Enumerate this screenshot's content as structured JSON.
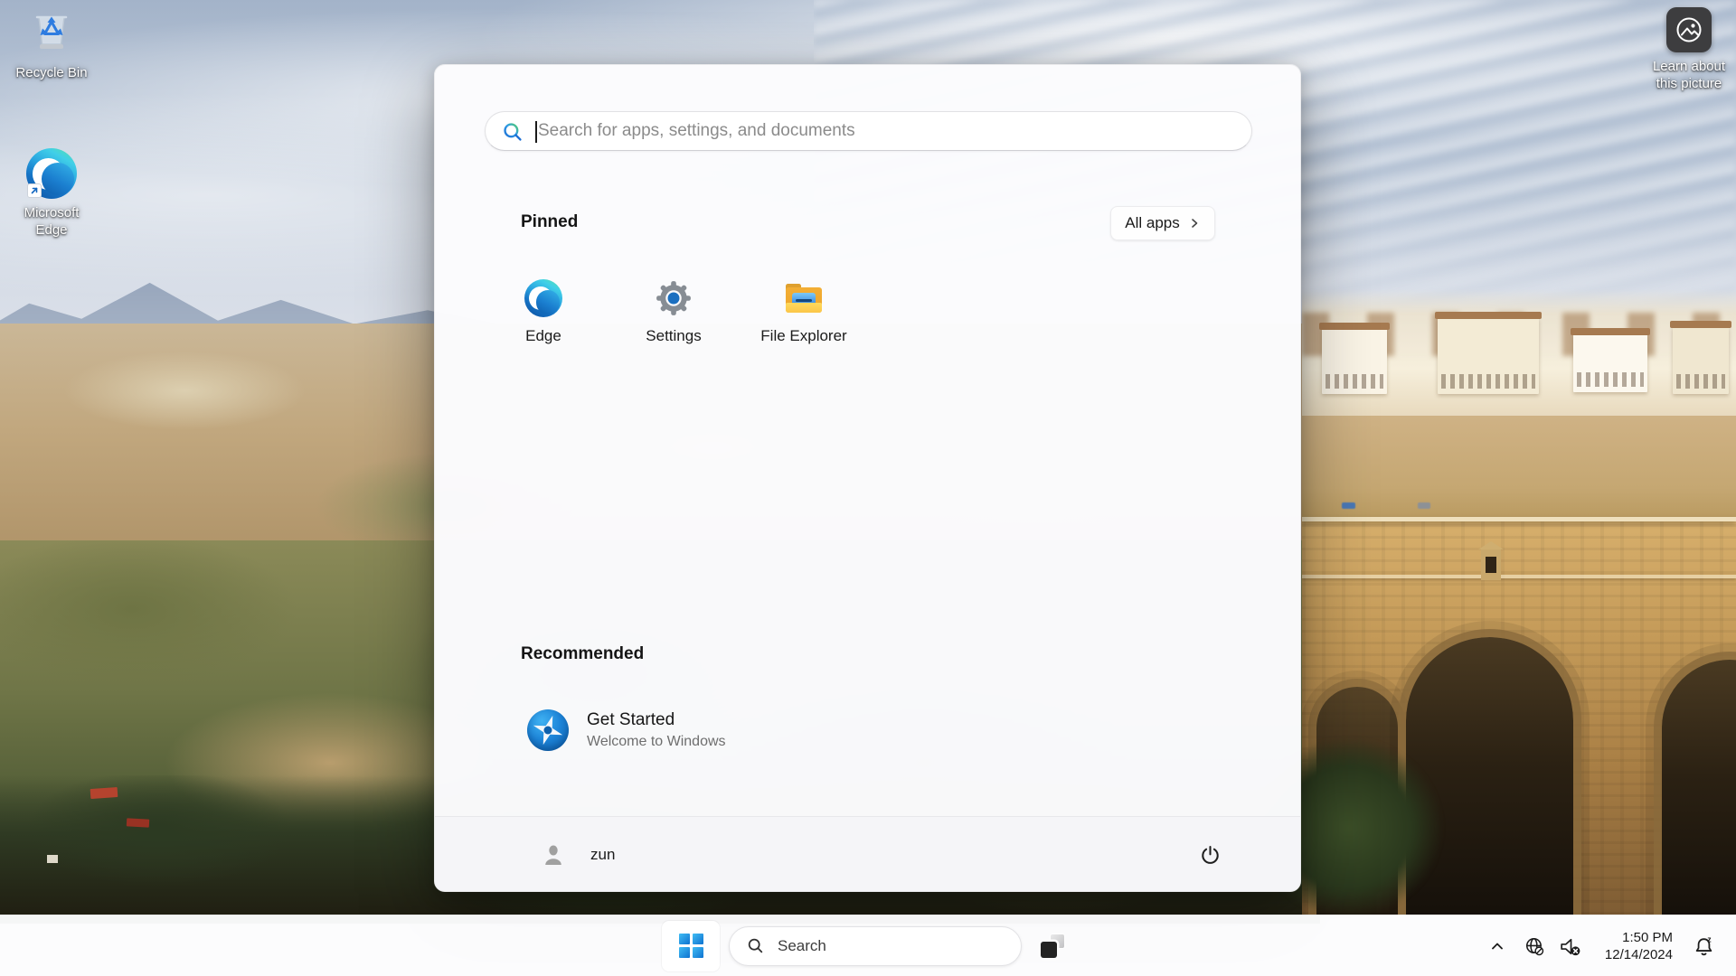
{
  "colors": {
    "accent": "#0078d4",
    "taskbar_bg": "#fcfcfd",
    "menu_bg": "#fbfbfd",
    "folder_yellow": "#f3ae35",
    "edge_blue": "#0b5ba8"
  },
  "desktop": {
    "icons": [
      {
        "label": "Recycle Bin"
      },
      {
        "label": "Microsoft Edge"
      }
    ],
    "learn_about_label": "Learn about this picture"
  },
  "start_menu": {
    "search_placeholder": "Search for apps, settings, and documents",
    "pinned_title": "Pinned",
    "all_apps_label": "All apps",
    "pinned_apps": [
      {
        "label": "Edge"
      },
      {
        "label": "Settings"
      },
      {
        "label": "File Explorer"
      }
    ],
    "recommended_title": "Recommended",
    "recommended": [
      {
        "title": "Get Started",
        "subtitle": "Welcome to Windows"
      }
    ],
    "user_name": "zun"
  },
  "taskbar": {
    "search_label": "Search",
    "clock": {
      "time": "1:50 PM",
      "date": "12/14/2024"
    }
  }
}
